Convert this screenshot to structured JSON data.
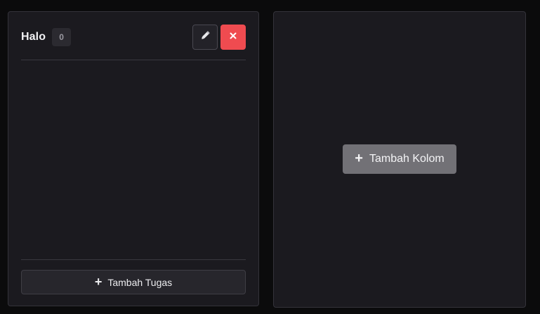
{
  "columns": [
    {
      "title": "Halo",
      "count": "0",
      "edit_icon": "pencil-icon",
      "delete_icon": "close-icon",
      "add_task_label": "Tambah Tugas"
    }
  ],
  "add_column": {
    "label": "Tambah Kolom"
  },
  "icons": {
    "plus": "+",
    "close": "×"
  },
  "colors": {
    "background": "#0b0b0c",
    "panel": "#1b1a1f",
    "danger": "#ef4b50",
    "button_gray": "#727176"
  }
}
